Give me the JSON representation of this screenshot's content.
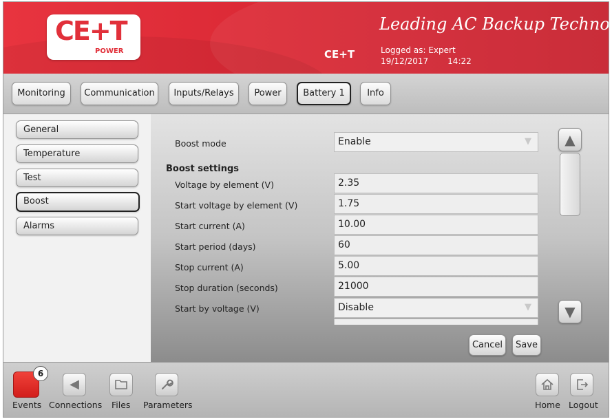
{
  "header": {
    "logo_text": "CE+T",
    "logo_sub": "POWER",
    "tagline": "Leading AC Backup Technology",
    "brand": "CE+T",
    "logged_as": "Logged as: Expert",
    "date": "19/12/2017",
    "time": "14:22"
  },
  "tabs": [
    {
      "label": "Monitoring"
    },
    {
      "label": "Communication"
    },
    {
      "label": "Inputs/Relays"
    },
    {
      "label": "Power"
    },
    {
      "label": "Battery 1",
      "active": true
    },
    {
      "label": "Info"
    }
  ],
  "sidebar": {
    "items": [
      {
        "label": "General"
      },
      {
        "label": "Temperature"
      },
      {
        "label": "Test"
      },
      {
        "label": "Boost",
        "active": true
      },
      {
        "label": "Alarms"
      }
    ]
  },
  "main": {
    "boost_mode": {
      "label": "Boost mode",
      "value": "Enable"
    },
    "section_title": "Boost settings",
    "rows": [
      {
        "label": "Voltage by element (V)",
        "value": "2.35"
      },
      {
        "label": "Start voltage by element (V)",
        "value": "1.75"
      },
      {
        "label": "Start current (A)",
        "value": "10.00"
      },
      {
        "label": "Start period (days)",
        "value": "60"
      },
      {
        "label": "Stop current (A)",
        "value": "5.00"
      },
      {
        "label": "Stop duration (seconds)",
        "value": "21000"
      }
    ],
    "start_by_voltage": {
      "label": "Start by voltage (V)",
      "value": "Disable"
    },
    "cancel_label": "Cancel",
    "save_label": "Save"
  },
  "bottombar": {
    "events_label": "Events",
    "events_count": "6",
    "connections_label": "Connections",
    "files_label": "Files",
    "parameters_label": "Parameters",
    "home_label": "Home",
    "logout_label": "Logout"
  },
  "icons": {
    "dropdown": "chevron-down-icon",
    "scroll_up": "arrow-up-icon",
    "scroll_down": "arrow-down-icon",
    "connections": "play-icon",
    "files": "folder-icon",
    "parameters": "wrench-icon",
    "home": "house-icon",
    "logout": "logout-icon"
  },
  "colors": {
    "header_red": "#dc2a36",
    "events_red": "#e0302a"
  }
}
